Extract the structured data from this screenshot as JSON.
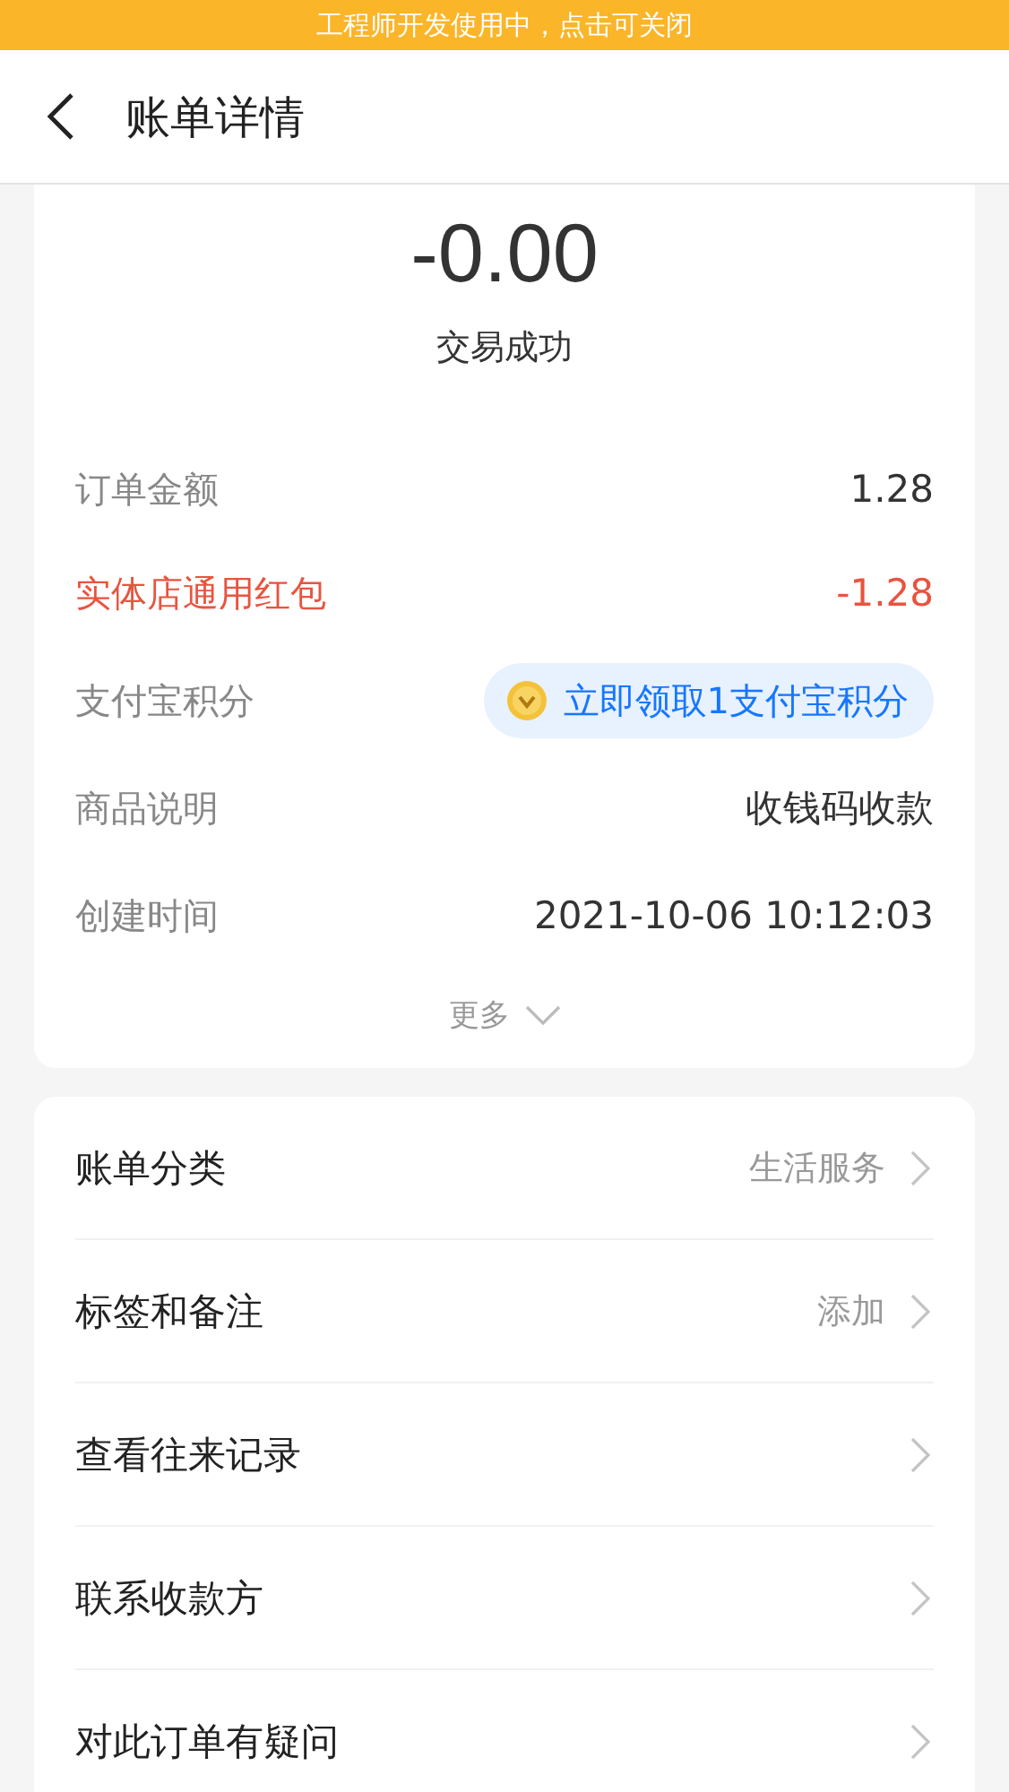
{
  "dev_banner": {
    "text": "工程师开发使用中，点击可关闭"
  },
  "header": {
    "title": "账单详情"
  },
  "summary": {
    "amount": "-0.00",
    "status": "交易成功"
  },
  "details": [
    {
      "kind": "plain",
      "label": "订单金额",
      "value": "1.28"
    },
    {
      "kind": "discount",
      "label": "实体店通用红包",
      "value": "-1.28"
    },
    {
      "kind": "badge",
      "label": "支付宝积分",
      "value": "立即领取1支付宝积分"
    },
    {
      "kind": "plain",
      "label": "商品说明",
      "value": "收钱码收款"
    },
    {
      "kind": "plain",
      "label": "创建时间",
      "value": "2021-10-06 10:12:03"
    }
  ],
  "more": {
    "label": "更多"
  },
  "actions": [
    {
      "label": "账单分类",
      "value": "生活服务"
    },
    {
      "label": "标签和备注",
      "value": "添加"
    },
    {
      "label": "查看往来记录"
    },
    {
      "label": "联系收款方"
    },
    {
      "label": "对此订单有疑问"
    }
  ]
}
